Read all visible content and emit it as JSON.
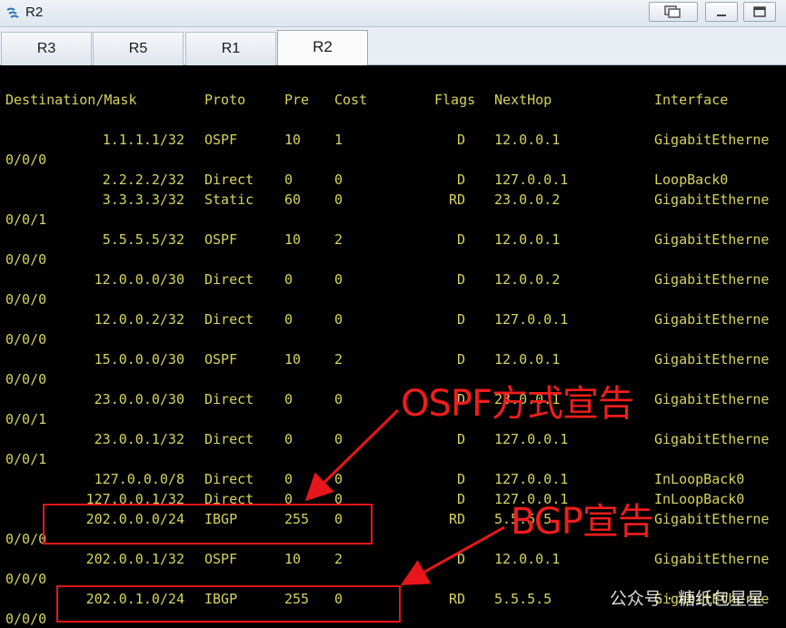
{
  "window": {
    "title": "R2"
  },
  "tabs": [
    {
      "label": "R3",
      "active": false
    },
    {
      "label": "R5",
      "active": false
    },
    {
      "label": "R1",
      "active": false
    },
    {
      "label": "R2",
      "active": true
    }
  ],
  "terminal": {
    "header": {
      "destination": "Destination/Mask",
      "proto": "Proto",
      "pre": "Pre",
      "cost": "Cost",
      "flags": "Flags",
      "nexthop": "NextHop",
      "interface": "Interface"
    },
    "routes": [
      {
        "dest": "1.1.1.1/32",
        "proto": "OSPF",
        "pre": "10",
        "cost": "1",
        "flags": "D",
        "nexthop": "12.0.0.1",
        "iface": "GigabitEtherne",
        "cont": "0/0/0"
      },
      {
        "dest": "2.2.2.2/32",
        "proto": "Direct",
        "pre": "0",
        "cost": "0",
        "flags": "D",
        "nexthop": "127.0.0.1",
        "iface": "LoopBack0",
        "cont": ""
      },
      {
        "dest": "3.3.3.3/32",
        "proto": "Static",
        "pre": "60",
        "cost": "0",
        "flags": "RD",
        "nexthop": "23.0.0.2",
        "iface": "GigabitEtherne",
        "cont": "0/0/1"
      },
      {
        "dest": "5.5.5.5/32",
        "proto": "OSPF",
        "pre": "10",
        "cost": "2",
        "flags": "D",
        "nexthop": "12.0.0.1",
        "iface": "GigabitEtherne",
        "cont": "0/0/0"
      },
      {
        "dest": "12.0.0.0/30",
        "proto": "Direct",
        "pre": "0",
        "cost": "0",
        "flags": "D",
        "nexthop": "12.0.0.2",
        "iface": "GigabitEtherne",
        "cont": "0/0/0"
      },
      {
        "dest": "12.0.0.2/32",
        "proto": "Direct",
        "pre": "0",
        "cost": "0",
        "flags": "D",
        "nexthop": "127.0.0.1",
        "iface": "GigabitEtherne",
        "cont": "0/0/0"
      },
      {
        "dest": "15.0.0.0/30",
        "proto": "OSPF",
        "pre": "10",
        "cost": "2",
        "flags": "D",
        "nexthop": "12.0.0.1",
        "iface": "GigabitEtherne",
        "cont": "0/0/0"
      },
      {
        "dest": "23.0.0.0/30",
        "proto": "Direct",
        "pre": "0",
        "cost": "0",
        "flags": "D",
        "nexthop": "23.0.0.1",
        "iface": "GigabitEtherne",
        "cont": "0/0/1"
      },
      {
        "dest": "23.0.0.1/32",
        "proto": "Direct",
        "pre": "0",
        "cost": "0",
        "flags": "D",
        "nexthop": "127.0.0.1",
        "iface": "GigabitEtherne",
        "cont": "0/0/1"
      },
      {
        "dest": "127.0.0.0/8",
        "proto": "Direct",
        "pre": "0",
        "cost": "0",
        "flags": "D",
        "nexthop": "127.0.0.1",
        "iface": "InLoopBack0",
        "cont": ""
      },
      {
        "dest": "127.0.0.1/32",
        "proto": "Direct",
        "pre": "0",
        "cost": "0",
        "flags": "D",
        "nexthop": "127.0.0.1",
        "iface": "InLoopBack0",
        "cont": ""
      },
      {
        "dest": "202.0.0.0/24",
        "proto": "IBGP",
        "pre": "255",
        "cost": "0",
        "flags": "RD",
        "nexthop": "5.5.5.5",
        "iface": "GigabitEtherne",
        "cont": "0/0/0"
      },
      {
        "dest": "202.0.0.1/32",
        "proto": "OSPF",
        "pre": "10",
        "cost": "2",
        "flags": "D",
        "nexthop": "12.0.0.1",
        "iface": "GigabitEtherne",
        "cont": "0/0/0"
      },
      {
        "dest": "202.0.1.0/24",
        "proto": "IBGP",
        "pre": "255",
        "cost": "0",
        "flags": "RD",
        "nexthop": "5.5.5.5",
        "iface": "GigabitEtherne",
        "cont": "0/0/0"
      }
    ]
  },
  "annotations": {
    "ospf_label": "OSPF方式宣告",
    "bgp_label": "BGP宣告",
    "color": "#f01d1d"
  },
  "watermark": "公众号 · 糖纸包星星",
  "colors": {
    "terminal_bg": "#000000",
    "terminal_text": "#d6d35a"
  }
}
